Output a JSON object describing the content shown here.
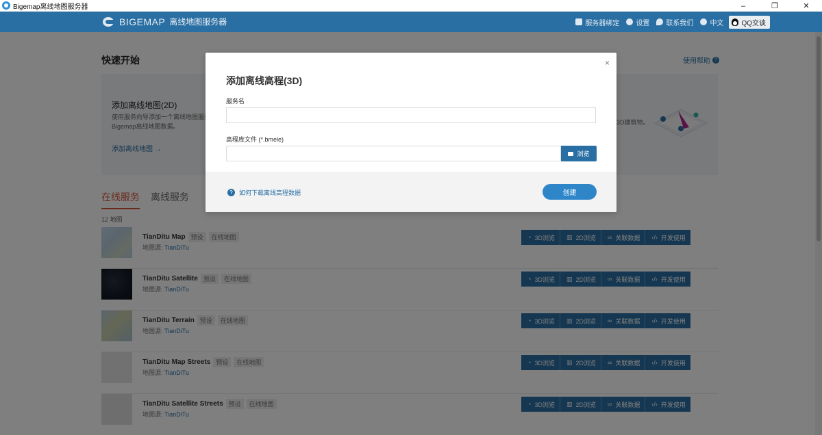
{
  "window": {
    "title": "Bigemap离线地图服务器",
    "controls": [
      "–",
      "❐",
      "✕"
    ]
  },
  "header": {
    "logo_text": "BIGEMAP",
    "logo_sub": "离线地图服务器",
    "nav": [
      {
        "label": "服务器绑定",
        "icon": "server-icon"
      },
      {
        "label": "设置",
        "icon": "gear-icon"
      },
      {
        "label": "联系我们",
        "icon": "chat-icon"
      },
      {
        "label": "中文",
        "icon": "globe-icon"
      }
    ],
    "qq_label": "QQ交谈"
  },
  "quickstart": {
    "title": "快速开始",
    "help_label": "使用帮助",
    "card": {
      "title": "添加离线地图(2D)",
      "desc": "使用服务向导添加一个离线地图服务，Bigemap离线地图数据。",
      "link": "添加离线地图 →",
      "right_text": "3D建筑物。"
    }
  },
  "tabs": {
    "online": "在线服务",
    "offline": "离线服务"
  },
  "count_label": "12 地图",
  "rows": [
    {
      "name": "TianDitu Map",
      "tag1": "预设",
      "tag2": "在线地图",
      "src_label": "地图源:",
      "src": "TianDiTu",
      "thumb_color": "#b9cde0"
    },
    {
      "name": "TianDitu Satellite",
      "tag1": "预设",
      "tag2": "在线地图",
      "src_label": "地图源:",
      "src": "TianDiTu",
      "thumb_color": "#1c2433"
    },
    {
      "name": "TianDitu Terrain",
      "tag1": "预设",
      "tag2": "在线地图",
      "src_label": "地图源:",
      "src": "TianDiTu",
      "thumb_color": "#a9c3d8"
    },
    {
      "name": "TianDitu Map Streets",
      "tag1": "预设",
      "tag2": "在线地图",
      "src_label": "地图源:",
      "src": "TianDiTu",
      "thumb_color": "#e4e4e4"
    },
    {
      "name": "TianDitu Satellite Streets",
      "tag1": "预设",
      "tag2": "在线地图",
      "src_label": "地图源:",
      "src": "TianDiTu",
      "thumb_color": "#dedede"
    }
  ],
  "actions": {
    "view3d": "3D浏览",
    "view2d": "2D浏览",
    "linked": "关联数据",
    "dev": "开发使用"
  },
  "modal": {
    "title": "添加离线高程(3D)",
    "close": "×",
    "service_label": "服务名",
    "service_value": "",
    "file_label": "高程库文件 (*.bmele)",
    "file_value": "",
    "browse_label": "浏览",
    "help_link": "如何下载离线高程数据",
    "create_label": "创建"
  }
}
